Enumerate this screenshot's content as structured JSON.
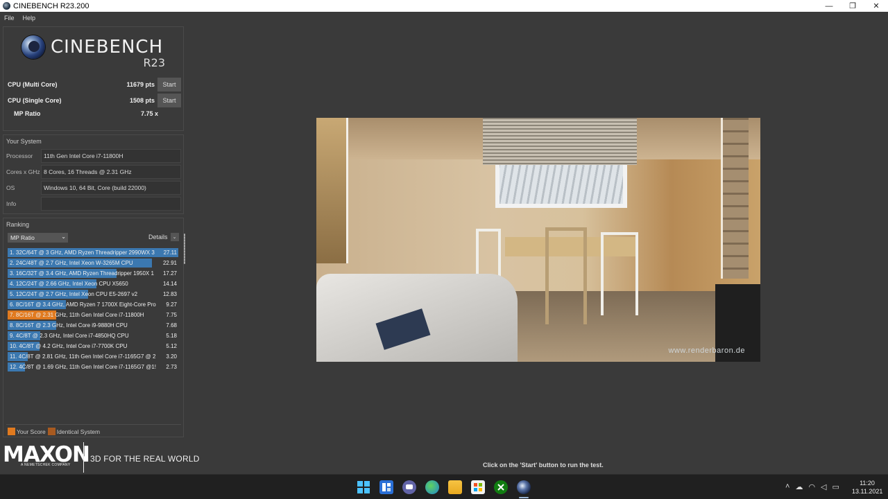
{
  "window": {
    "title": "CINEBENCH R23.200",
    "minimize": "—",
    "maximize": "❐",
    "close": "✕"
  },
  "menu": {
    "file": "File",
    "help": "Help"
  },
  "logo": {
    "name": "CINEBENCH",
    "version": "R23"
  },
  "scores": {
    "multi": {
      "label": "CPU (Multi Core)",
      "value": "11679 pts",
      "button": "Start"
    },
    "single": {
      "label": "CPU (Single Core)",
      "value": "1508 pts",
      "button": "Start"
    },
    "mp_ratio": {
      "label": "MP Ratio",
      "value": "7.75 x"
    }
  },
  "system": {
    "title": "Your System",
    "rows": [
      {
        "key": "Processor",
        "value": "11th Gen Intel Core i7-11800H"
      },
      {
        "key": "Cores x GHz",
        "value": "8 Cores, 16 Threads @ 2.31 GHz"
      },
      {
        "key": "OS",
        "value": "Windows 10, 64 Bit, Core (build 22000)"
      },
      {
        "key": "Info",
        "value": ""
      }
    ]
  },
  "ranking": {
    "title": "Ranking",
    "dropdown": "MP Ratio",
    "details": "Details",
    "max": 27.11,
    "rows": [
      {
        "text": "1. 32C/64T @ 3 GHz, AMD Ryzen Threadripper 2990WX 3",
        "value": "27.11",
        "score": 27.11,
        "mine": false
      },
      {
        "text": "2. 24C/48T @ 2.7 GHz, Intel Xeon W-3265M CPU",
        "value": "22.91",
        "score": 22.91,
        "mine": false
      },
      {
        "text": "3. 16C/32T @ 3.4 GHz, AMD Ryzen Threadripper 1950X 1",
        "value": "17.27",
        "score": 17.27,
        "mine": false
      },
      {
        "text": "4. 12C/24T @ 2.66 GHz, Intel Xeon CPU X5650",
        "value": "14.14",
        "score": 14.14,
        "mine": false
      },
      {
        "text": "5. 12C/24T @ 2.7 GHz, Intel Xeon CPU E5-2697 v2",
        "value": "12.83",
        "score": 12.83,
        "mine": false
      },
      {
        "text": "6. 8C/16T @ 3.4 GHz, AMD Ryzen 7 1700X Eight-Core Proc",
        "value": "9.27",
        "score": 9.27,
        "mine": false
      },
      {
        "text": "7. 8C/16T @ 2.31 GHz, 11th Gen Intel Core i7-11800H",
        "value": "7.75",
        "score": 7.75,
        "mine": true
      },
      {
        "text": "8. 8C/16T @ 2.3 GHz, Intel Core i9-9880H CPU",
        "value": "7.68",
        "score": 7.68,
        "mine": false
      },
      {
        "text": "9. 4C/8T @ 2.3 GHz, Intel Core i7-4850HQ CPU",
        "value": "5.18",
        "score": 5.18,
        "mine": false
      },
      {
        "text": "10. 4C/8T @ 4.2 GHz, Intel Core i7-7700K CPU",
        "value": "5.12",
        "score": 5.12,
        "mine": false
      },
      {
        "text": "11. 4C/8T @ 2.81 GHz, 11th Gen Intel Core i7-1165G7 @ 2",
        "value": "3.20",
        "score": 3.2,
        "mine": false
      },
      {
        "text": "12. 4C/8T @ 1.69 GHz, 11th Gen Intel Core i7-1165G7 @1!",
        "value": "2.73",
        "score": 2.73,
        "mine": false
      }
    ],
    "legend": {
      "your_score": "Your Score",
      "identical": "Identical System"
    }
  },
  "colors": {
    "bar": "#3b78b0",
    "mine": "#e07a1f",
    "identical": "#a85a20"
  },
  "branding": {
    "maxon": "MAXON",
    "sub": "A NEMETSCHEK COMPANY",
    "tagline": "3D FOR THE REAL WORLD"
  },
  "render": {
    "watermark": "www.renderbaron.de"
  },
  "hint": "Click on the 'Start' button to run the test.",
  "taskbar": {
    "icons": [
      "start-icon",
      "widgets-icon",
      "chat-icon",
      "edge-icon",
      "explorer-icon",
      "store-icon",
      "xbox-icon",
      "cinebench-icon"
    ],
    "time": "11:20",
    "date": "13.11.2021"
  }
}
